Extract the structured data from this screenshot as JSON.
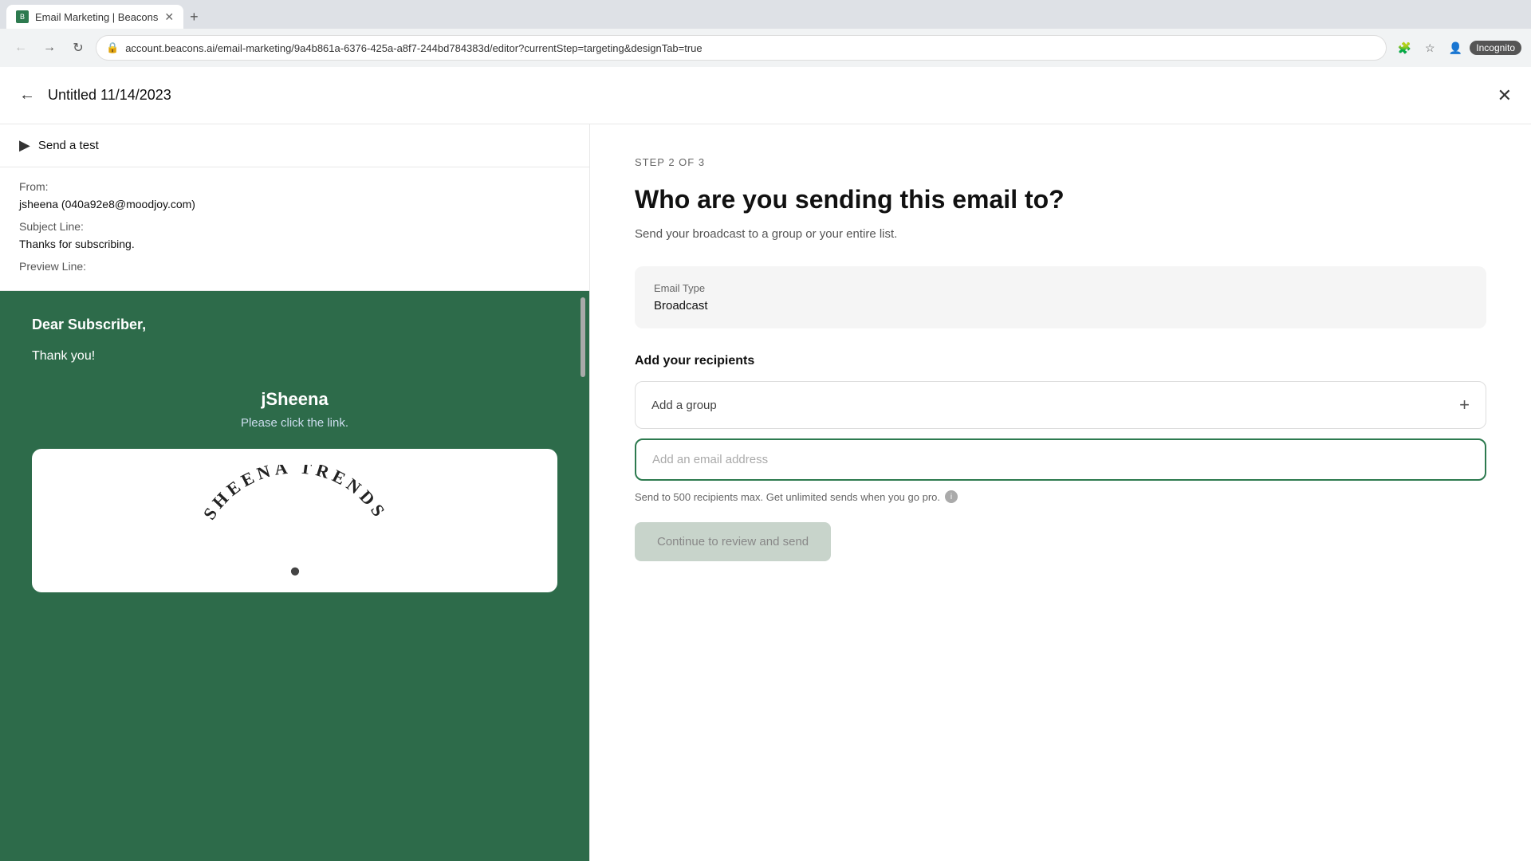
{
  "browser": {
    "tab_title": "Email Marketing | Beacons",
    "tab_favicon": "B",
    "url": "account.beacons.ai/email-marketing/9a4b861a-6376-425a-a8f7-244bd784383d/editor?currentStep=targeting&designTab=true",
    "incognito_label": "Incognito"
  },
  "app": {
    "title": "Untitled 11/14/2023",
    "back_icon": "←",
    "close_icon": "✕"
  },
  "left_panel": {
    "send_test_label": "Send a test",
    "send_test_icon": "➤",
    "from_label": "From:",
    "from_value": "jsheena (040a92e8@moodjoy.com)",
    "subject_label": "Subject Line:",
    "subject_value": "Thanks for subscribing.",
    "preview_label": "Preview Line:",
    "preview_value": "",
    "email_dear": "Dear Subscriber,",
    "email_body": "Thank you!",
    "email_name": "jSheena",
    "email_link": "Please click the link.",
    "sheena_text": "SHEENA TRENDS"
  },
  "right_panel": {
    "step_label": "STEP 2 OF 3",
    "section_title": "Who are you sending this email to?",
    "section_subtitle": "Send your broadcast to a group or your entire list.",
    "email_type_label": "Email Type",
    "email_type_value": "Broadcast",
    "recipients_label": "Add your recipients",
    "add_group_placeholder": "Add a group",
    "add_group_plus": "+",
    "email_input_placeholder": "Add an email address",
    "limit_text": "Send to 500 recipients max. Get unlimited sends when you go pro.",
    "continue_btn": "Continue to review and send"
  }
}
